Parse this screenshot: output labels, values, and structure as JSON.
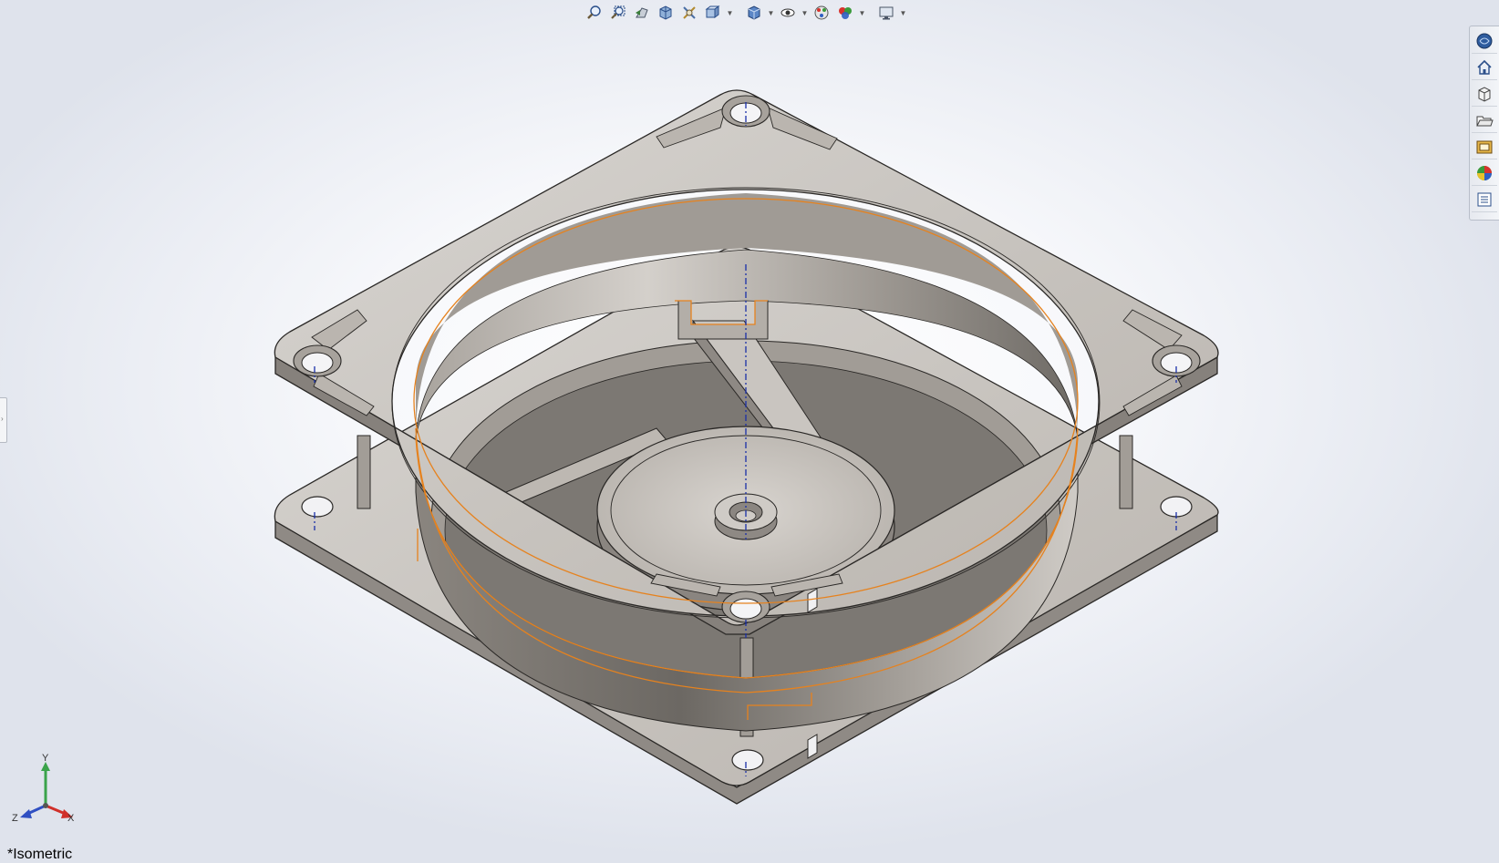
{
  "viewport": {
    "view_name": "*Isometric"
  },
  "hud_toolbar": {
    "buttons": [
      {
        "name": "zoom-to-fit-icon"
      },
      {
        "name": "zoom-to-area-icon"
      },
      {
        "name": "previous-view-icon"
      },
      {
        "name": "section-view-icon"
      },
      {
        "name": "dynamic-annotation-views-icon"
      },
      {
        "name": "view-orientation-icon",
        "has_dropdown": true
      },
      {
        "name": "display-style-icon",
        "has_dropdown": true
      },
      {
        "name": "hide-show-items-icon",
        "has_dropdown": true
      },
      {
        "name": "edit-appearance-icon"
      },
      {
        "name": "apply-scene-icon",
        "has_dropdown": true
      },
      {
        "name": "view-settings-icon",
        "has_dropdown": true
      }
    ]
  },
  "task_pane": {
    "tabs": [
      {
        "name": "solidworks-resources-icon"
      },
      {
        "name": "home-icon"
      },
      {
        "name": "design-library-icon"
      },
      {
        "name": "file-explorer-icon"
      },
      {
        "name": "view-palette-icon"
      },
      {
        "name": "appearances-scenes-icon"
      },
      {
        "name": "custom-properties-icon"
      }
    ]
  },
  "triad": {
    "x_label": "X",
    "y_label": "Y",
    "z_label": "Z",
    "x_color": "#d0302a",
    "y_color": "#3aa34a",
    "z_color": "#2f4fc2"
  },
  "colors": {
    "model_top": "#cdc9c4",
    "model_shadow": "#7e7a76",
    "edge": "#2a2826",
    "selection": "#e6821e",
    "centerline": "#1a2fa8"
  }
}
